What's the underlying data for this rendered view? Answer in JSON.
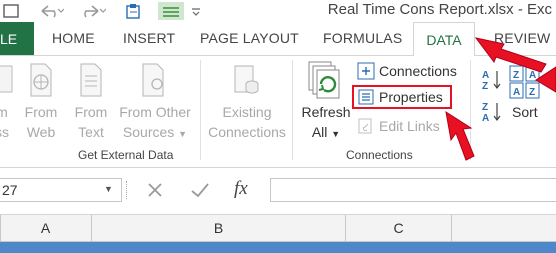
{
  "window": {
    "title": "Real Time Cons Report.xlsx - Exc"
  },
  "tabs": {
    "file": "LE",
    "items": [
      "HOME",
      "INSERT",
      "PAGE LAYOUT",
      "FORMULAS",
      "DATA",
      "REVIEW"
    ]
  },
  "ribbon": {
    "get_external": {
      "from_access": [
        "m",
        "ss"
      ],
      "from_web": [
        "From",
        "Web"
      ],
      "from_text": [
        "From",
        "Text"
      ],
      "from_other": [
        "From Other",
        "Sources"
      ],
      "existing": [
        "Existing",
        "Connections"
      ],
      "group_label": "Get External Data"
    },
    "connections": {
      "refresh": [
        "Refresh",
        "All"
      ],
      "connections_btn": "Connections",
      "properties_btn": "Properties",
      "edit_links_btn": "Edit Links",
      "group_label": "Connections"
    },
    "sort": {
      "label": "Sort"
    }
  },
  "formula_bar": {
    "name_box": "27",
    "fx": "fx",
    "formula": ""
  },
  "columns": [
    "A",
    "B",
    "C"
  ],
  "colors": {
    "accent": "#217346",
    "highlight": "#e81123",
    "selected_column": "#4e88c8"
  }
}
